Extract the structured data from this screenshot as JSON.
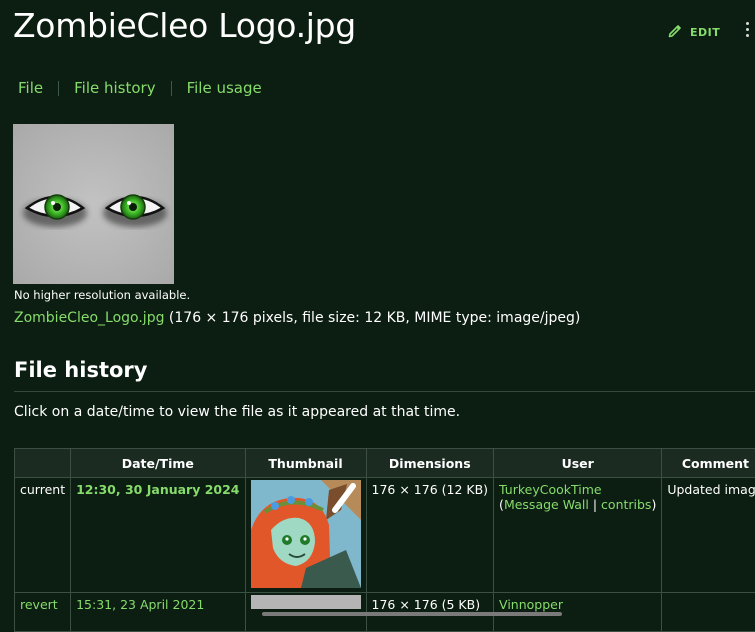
{
  "page": {
    "title": "ZombieCleo Logo.jpg",
    "edit_label": "EDIT"
  },
  "tabs": [
    "File",
    "File history",
    "File usage"
  ],
  "file": {
    "no_higher_resolution": "No higher resolution available.",
    "link_name": "ZombieCleo_Logo.jpg",
    "details": " (176 × 176 pixels, file size: 12 KB, MIME type: image/jpeg)"
  },
  "history": {
    "heading": "File history",
    "hint": "Click on a date/time to view the file as it appeared at that time.",
    "columns": [
      "",
      "Date/Time",
      "Thumbnail",
      "Dimensions",
      "User",
      "Comment"
    ],
    "rows": [
      {
        "status": "current",
        "datetime": "12:30, 30 January 2024",
        "dimensions": "176 × 176 (12 KB)",
        "user": "TurkeyCookTime",
        "open_paren": "(",
        "message_wall": "Message Wall",
        "separator": " | ",
        "contribs": "contribs",
        "close_paren": ")",
        "comment": "Updated image"
      },
      {
        "status": "revert",
        "datetime": "15:31, 23 April 2021",
        "dimensions": "176 × 176 (5 KB)",
        "user": "Vinnopper",
        "comment": ""
      }
    ]
  },
  "colors": {
    "background": "#0c1d12",
    "link": "#86dc6a",
    "header_bg": "#1c2b21",
    "border": "#3b4f43"
  }
}
